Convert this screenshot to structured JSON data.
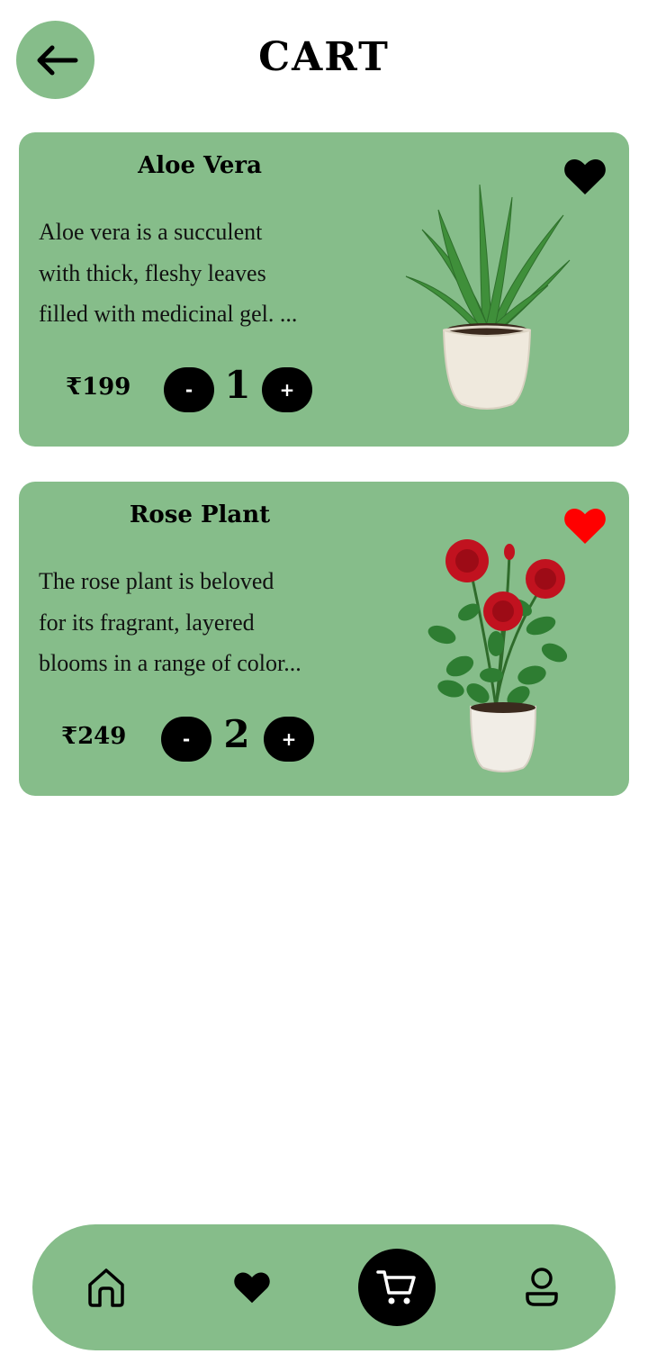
{
  "header": {
    "title": "CART",
    "back_icon": "arrow-left-icon"
  },
  "colors": {
    "card_bg": "#86bd8a",
    "favorite_active": "#ff0000",
    "favorite_default": "#000000",
    "button_bg": "#000000"
  },
  "items": [
    {
      "name": "Aloe Vera",
      "description": "Aloe vera is a succulent\nwith thick, fleshy leaves\nfilled with medicinal gel. ...",
      "price": "₹199",
      "quantity": "1",
      "minus_label": "-",
      "plus_label": "+",
      "favorite": false,
      "image": "aloe-vera-plant"
    },
    {
      "name": "Rose Plant",
      "description": "The rose plant is beloved\nfor its fragrant, layered\nblooms in a range of color...",
      "price": "₹249",
      "quantity": "2",
      "minus_label": "-",
      "plus_label": "+",
      "favorite": true,
      "image": "rose-plant"
    }
  ],
  "bottom_nav": {
    "items": [
      {
        "icon": "home-icon"
      },
      {
        "icon": "heart-icon"
      },
      {
        "icon": "cart-icon",
        "active": true
      },
      {
        "icon": "profile-icon"
      }
    ]
  }
}
